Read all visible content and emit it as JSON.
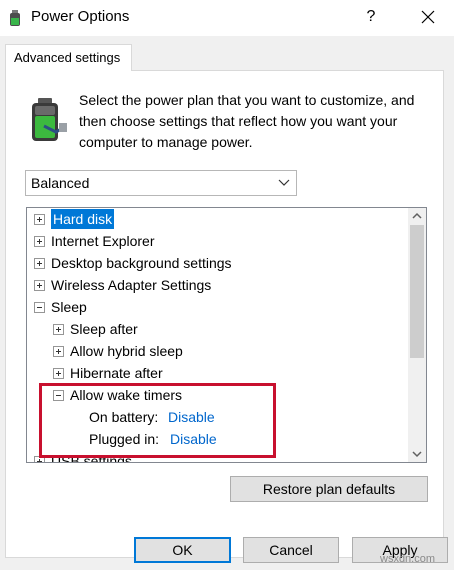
{
  "window": {
    "title": "Power Options",
    "help_glyph": "?",
    "tab_label": "Advanced settings"
  },
  "description": "Select the power plan that you want to customize, and then choose settings that reflect how you want your computer to manage power.",
  "plan_select": {
    "value": "Balanced"
  },
  "tree": [
    {
      "label": "Hard disk",
      "level": 0,
      "expander": "plus",
      "selected": true
    },
    {
      "label": "Internet Explorer",
      "level": 0,
      "expander": "plus"
    },
    {
      "label": "Desktop background settings",
      "level": 0,
      "expander": "plus"
    },
    {
      "label": "Wireless Adapter Settings",
      "level": 0,
      "expander": "plus"
    },
    {
      "label": "Sleep",
      "level": 0,
      "expander": "minus"
    },
    {
      "label": "Sleep after",
      "level": 1,
      "expander": "plus"
    },
    {
      "label": "Allow hybrid sleep",
      "level": 1,
      "expander": "plus"
    },
    {
      "label": "Hibernate after",
      "level": 1,
      "expander": "plus"
    },
    {
      "label": "Allow wake timers",
      "level": 1,
      "expander": "minus"
    },
    {
      "label": "On battery:",
      "value": "Disable",
      "level": 2
    },
    {
      "label": "Plugged in:",
      "value": "Disable",
      "level": 2
    },
    {
      "label": "USB settings",
      "level": 0,
      "expander": "plus"
    }
  ],
  "buttons": {
    "restore": "Restore plan defaults",
    "ok": "OK",
    "cancel": "Cancel",
    "apply": "Apply"
  },
  "watermark": "wsxdn.com",
  "colors": {
    "selection": "#0078d7",
    "link": "#0066cc",
    "highlight_box": "#c8102e"
  }
}
